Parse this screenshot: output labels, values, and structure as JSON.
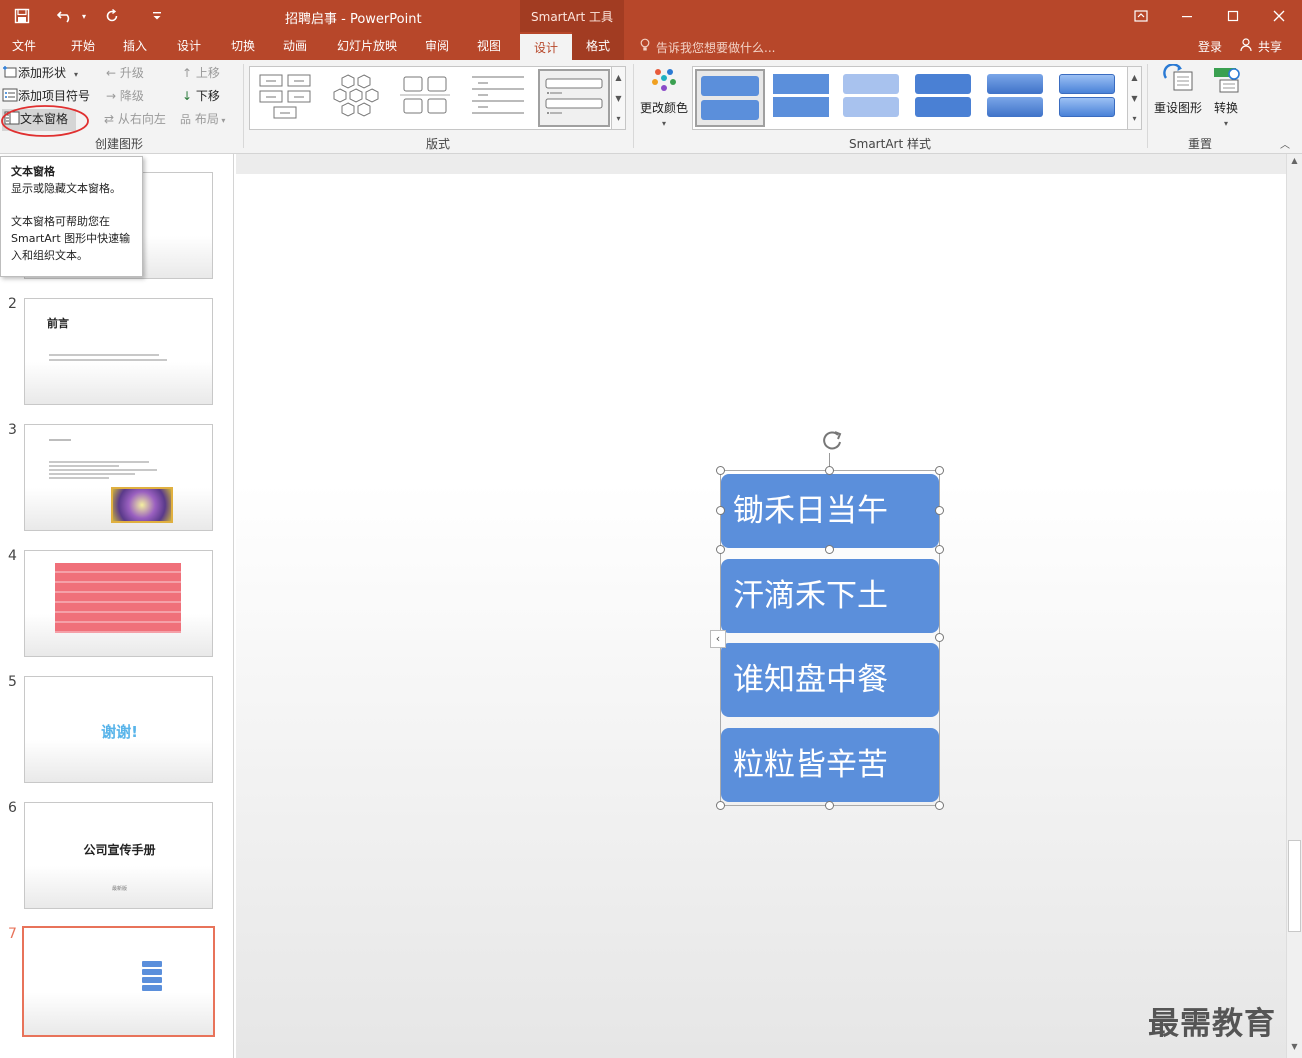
{
  "window": {
    "title": "招聘启事 - PowerPoint",
    "context_tools": "SmartArt 工具"
  },
  "tabs": [
    "文件",
    "开始",
    "插入",
    "设计",
    "切换",
    "动画",
    "幻灯片放映",
    "审阅",
    "视图"
  ],
  "context_tabs": [
    "设计",
    "格式"
  ],
  "tell_me": "告诉我您想要做什么...",
  "account": {
    "login": "登录",
    "share": "共享"
  },
  "ribbon": {
    "create": {
      "add_shape": "添加形状",
      "add_bullet": "添加项目符号",
      "text_pane": "文本窗格",
      "promote": "升级",
      "demote": "降级",
      "rtl": "从右向左",
      "move_up": "上移",
      "move_down": "下移",
      "layout": "布局",
      "label": "创建图形"
    },
    "layouts": {
      "label": "版式"
    },
    "styles": {
      "change_colors": "更改颜色",
      "label": "SmartArt 样式"
    },
    "reset": {
      "reset_graphic": "重设图形",
      "convert": "转换",
      "label": "重置"
    }
  },
  "tooltip": {
    "title": "文本窗格",
    "line1": "显示或隐藏文本窗格。",
    "line2": "文本窗格可帮助您在 SmartArt 图形中快速输入和组织文本。"
  },
  "slides": [
    {
      "num": "1"
    },
    {
      "num": "2",
      "title": "前言"
    },
    {
      "num": "3"
    },
    {
      "num": "4"
    },
    {
      "num": "5",
      "title": "谢谢!"
    },
    {
      "num": "6",
      "title": "公司宣传手册",
      "sub": "最新版"
    },
    {
      "num": "7"
    }
  ],
  "smartart": {
    "items": [
      "锄禾日当午",
      "汗滴禾下土",
      "谁知盘中餐",
      "粒粒皆辛苦"
    ]
  },
  "watermark": "最需教育",
  "colors": {
    "accent": "#b7472a",
    "shape": "#5b8fdb",
    "selection": "#e8735a"
  }
}
